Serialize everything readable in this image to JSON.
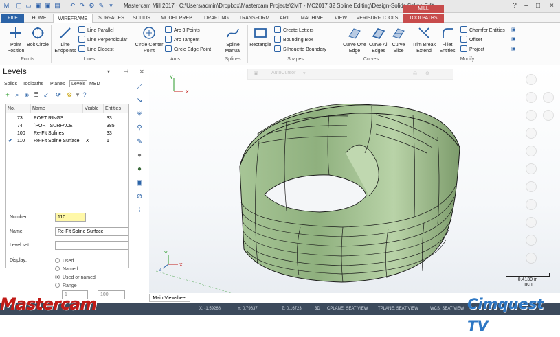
{
  "window": {
    "title": "Mastercam Mill 2017 · C:\\Users\\admin\\Dropbox\\Mastercam Projects\\2MT - MC2017 32 Spline Editing\\Design-Solids Spline Edit...",
    "controls": [
      "?",
      "–",
      "□",
      "×"
    ]
  },
  "tabs": [
    "FILE",
    "HOME",
    "WIREFRAME",
    "SURFACES",
    "SOLIDS",
    "MODEL PREP",
    "DRAFTING",
    "TRANSFORM",
    "ART",
    "MACHINE",
    "VIEW",
    "VERISURF TOOLS"
  ],
  "active_tab": "WIREFRAME",
  "context_tab": {
    "group": "MILL",
    "label": "TOOLPATHS"
  },
  "ribbon": {
    "points": {
      "label": "Points",
      "point_position": "Point Position",
      "bolt_circle": "Bolt Circle"
    },
    "lines": {
      "label": "Lines",
      "line_endpoints": "Line Endpoints",
      "line_parallel": "Line Parallel",
      "line_perpendicular": "Line Perpendicular",
      "line_closest": "Line Closest"
    },
    "arcs": {
      "label": "Arcs",
      "circle_center_point": "Circle Center Point",
      "arc_3_points": "Arc 3 Points",
      "arc_tangent": "Arc Tangent",
      "circle_edge_point": "Circle Edge Point"
    },
    "splines": {
      "label": "Splines",
      "spline_manual": "Spline Manual"
    },
    "shapes": {
      "label": "Shapes",
      "rectangle": "Rectangle",
      "create_letters": "Create Letters",
      "bounding_box": "Bounding Box",
      "silhouette_boundary": "Silhouette Boundary"
    },
    "curves": {
      "label": "Curves",
      "curve_one_edge": "Curve One Edge",
      "curve_all_edges": "Curve All Edges",
      "curve_slice": "Curve Slice"
    },
    "modify": {
      "label": "Modify",
      "trim_break_extend": "Trim Break Extend",
      "fillet_entities": "Fillet Entities",
      "chamfer_entities": "Chamfer Entities",
      "offset": "Offset",
      "project": "Project"
    }
  },
  "levels_panel": {
    "title": "Levels",
    "tabs": [
      "Solids",
      "Toolpaths",
      "Planes",
      "Levels",
      "MBD"
    ],
    "active_tab": "Levels",
    "columns": [
      "No.",
      "Name",
      "Visible",
      "Entities"
    ],
    "rows": [
      {
        "no": "73",
        "name": "PORT RINGS",
        "visible": "",
        "entities": "33",
        "active": false
      },
      {
        "no": "74",
        "name": "`PORT SURFACE",
        "visible": "",
        "entities": "385",
        "active": false
      },
      {
        "no": "100",
        "name": "Re-Fit Splines",
        "visible": "",
        "entities": "33",
        "active": false
      },
      {
        "no": "110",
        "name": "Re-Fit Spline Surface",
        "visible": "X",
        "entities": "1",
        "active": true
      }
    ],
    "form": {
      "number_label": "Number:",
      "number_value": "110",
      "name_label": "Name:",
      "name_value": "Re-Fit Spline Surface",
      "levelset_label": "Level set:",
      "levelset_value": "",
      "display_label": "Display:",
      "display_options": [
        "Used",
        "Named",
        "Used or named",
        "Range"
      ],
      "display_selected": "Used or named",
      "range_from": "1",
      "range_to": "100"
    }
  },
  "viewport": {
    "tab": "Main Viewsheet",
    "floating_toolbar_label": "AutoCursor",
    "scale_value": "0.4130 in",
    "scale_unit": "Inch"
  },
  "status": {
    "x": "X:   -1.59268",
    "y": "Y:   0.79637",
    "z": "Z:   0.16723",
    "mode": "3D",
    "cplane": "CPLANE: SEAT VIEW",
    "tplane": "TPLANE: SEAT VIEW",
    "wcs": "WCS: SEAT VIEW"
  },
  "branding": {
    "left": "Mastercam",
    "right": "Cimquest TV"
  },
  "colors": {
    "file_tab": "#2b63a7",
    "mill_tab": "#c84c4c",
    "surface": "#9fbe8c",
    "status_bg": "#3c4a5c"
  }
}
